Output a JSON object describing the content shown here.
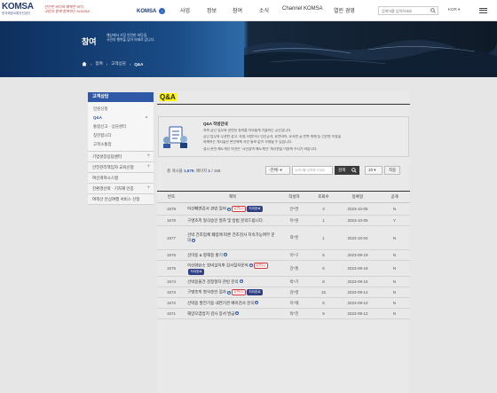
{
  "header": {
    "logo_text": "KOMSA",
    "logo_sub": "한국해양교통안전공단",
    "slogan_line1": "안전한 바다와 행복한 바다,",
    "slogan_line2": "국민과 함께 함께하는 KOMSA",
    "komsa_button": "KOMSA",
    "nav": [
      "사업",
      "정보",
      "참여",
      "소식",
      "Channel KOMSA",
      "열린 경영"
    ],
    "search_placeholder": "검색어를 입력하세요",
    "lang": "KOR"
  },
  "hero": {
    "title": "참여",
    "subtitle_line1": "해상에서 가장 안전한 바닷길,",
    "subtitle_line2": "국민의 행복을 담아 미래로 갑니다.",
    "breadcrumbs": [
      "참여",
      "고객상담",
      "Q&A"
    ]
  },
  "sidebar": {
    "head": "고객상담",
    "sub_items": [
      "민원신청",
      "Q&A",
      "통합신고 · 상담센터",
      "칭찬합니다",
      "고객소통함"
    ],
    "main_items": [
      "기업성장응답센터",
      "안전관리책임자 교육신청",
      "여선개혁시스템",
      "친환경선박 · 기자재 인증",
      "여객선 안심여행 서비스 신청"
    ]
  },
  "content": {
    "title": "Q&A",
    "info_head": "Q&A 작성안내",
    "info_lines": [
      "저희 공단 업무와 관련된 질의를 자유롭게 기술하는 공간입니다.",
      "공단 업무와 무관한 광고, 욕설, 비방이나 인신공격, 유언비어, 유사한 글 반복 게재 등 건전한 이용을",
      "저해하는 게시물은 본인에게 사전 통보 없이 삭제될 수 있습니다.",
      "접시 관련 제도개선 의견은 \"국민참여 제도개선\" 게시판을 이용해 주시기 바랍니다."
    ],
    "count_label": "총 게시물",
    "count_total": "1,679",
    "page_label": "페이지",
    "page_current": "1",
    "page_total": "168",
    "filter_select": "-전체-",
    "keyword_placeholder": "검색어를 입력해 주세요",
    "search_button": "검색",
    "per_page": "10",
    "apply_button": "적용"
  },
  "table": {
    "headers": [
      "번호",
      "제목",
      "작성자",
      "조회수",
      "등록일",
      "공개"
    ],
    "rows": [
      {
        "no": "1679",
        "title": "어선폐엔검사 관련 질의",
        "lock": true,
        "badges": [
          "답변(1)",
          "처리완료"
        ],
        "author": "안*연",
        "views": "3",
        "date": "2023-10-05",
        "pub": "N"
      },
      {
        "no": "1678",
        "title": "구명조끼 형식승인 절차 및 방법 문의드립니다.",
        "lock": false,
        "badges": [],
        "author": "이*원",
        "views": "1",
        "date": "2023-10-05",
        "pub": "Y"
      },
      {
        "no": "1677",
        "title": "선박 건조업체 폐업에 따른 건조검사 지속가능여부 문의",
        "lock": true,
        "badges": [],
        "author": "최*훈",
        "views": "1",
        "date": "2023-10-04",
        "pub": "N"
      },
      {
        "no": "1676",
        "title": "선미등 & 항해등 밝기",
        "lock": true,
        "badges": [],
        "author": "이*구",
        "views": "5",
        "date": "2023-09-19",
        "pub": "N"
      },
      {
        "no": "1675",
        "title": "이산화탄소 장비설치후 검사절차문의",
        "lock": true,
        "badges": [
          "답변(1)",
          "처리완료"
        ],
        "author": "강*홍",
        "views": "5",
        "date": "2023-09-18",
        "pub": "N"
      },
      {
        "no": "1674",
        "title": "선박용물건 검정절차 관련 문의",
        "lock": true,
        "badges": [],
        "author": "박*기",
        "views": "8",
        "date": "2023-09-15",
        "pub": "N"
      },
      {
        "no": "1673",
        "title": "구명조끼 형식승인 절차",
        "lock": true,
        "badges": [
          "답변(1)",
          "처리완료"
        ],
        "author": "김*병",
        "views": "15",
        "date": "2023-09-14",
        "pub": "N"
      },
      {
        "no": "1672",
        "title": "선박용 발전기용 내연기관 예비검사 문의",
        "lock": true,
        "badges": [],
        "author": "이*재",
        "views": "6",
        "date": "2023-09-13",
        "pub": "N"
      },
      {
        "no": "1671",
        "title": "해양오염방지 검사 증서 발급",
        "lock": true,
        "badges": [],
        "author": "박*진",
        "views": "9",
        "date": "2023-09-12",
        "pub": "N"
      }
    ]
  },
  "colors": {
    "accent": "#2f59a6",
    "badge_red": "#d23c3c",
    "badge_navy": "#2d3e82",
    "highlight": "#fff900"
  }
}
